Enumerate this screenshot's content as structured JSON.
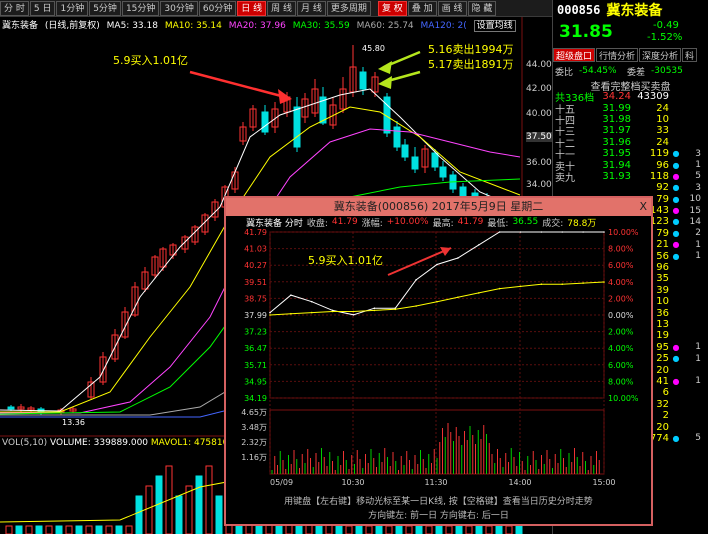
{
  "toolbar": {
    "periods": [
      "分 时",
      "5 日",
      "1分钟",
      "5分钟",
      "15分钟",
      "30分钟",
      "60分钟",
      "日 线",
      "周 线",
      "月 线",
      "更多周期"
    ],
    "active_period": "日 线",
    "right_buttons": [
      "复 权",
      "叠 加",
      "画 线",
      "隐 藏"
    ],
    "active_right": "复 权"
  },
  "legend": {
    "name": "冀东装备",
    "mode": "(日线,前复权)",
    "ma5": "MA5: 33.18",
    "ma10": "MA10: 35.14",
    "ma20": "MA20: 37.96",
    "ma30": "MA30: 35.59",
    "ma60": "MA60: 25.74",
    "ma120": "MA120: 2(",
    "settings": "设置均线"
  },
  "colors": {
    "up": "#ff3333",
    "down": "#00e0e0",
    "ma5": "#ffffff",
    "ma10": "#ffff00",
    "ma20": "#ff44ff",
    "ma30": "#00ff00",
    "ma60": "#aaaaaa",
    "ma120": "#4466ff",
    "price_line": "#ffffff",
    "avg_line": "#ffff00"
  },
  "annotations": {
    "buy_note": "5.9买入1.01亿",
    "sell_note1": "5.16卖出1994万",
    "sell_note2": "5.17卖出1891万",
    "popup_note": "5.9买入1.01亿",
    "peak": "45.80",
    "low": "13.36"
  },
  "price_axis": [
    "44.00",
    "42.00",
    "40.00",
    "37.50",
    "36.00",
    "34.00"
  ],
  "volume": {
    "label": "VOL(5,10)",
    "value": "VOLUME: 339889.000",
    "mavol": "MAVOL1: 475810"
  },
  "right_panel": {
    "code": "000856",
    "name": "冀东装备",
    "price": "31.85",
    "change": "-0.49",
    "pct": "-1.52%",
    "tabs": [
      "超级盘口",
      "行情分析",
      "深度分析",
      "科"
    ],
    "active_tab": "超级盘口",
    "ratio_label": "委比",
    "ratio_value": "-54.45%",
    "diff_label": "委差",
    "diff_value": "-30535",
    "full_book": "查看完整档买卖盘",
    "total_label": "共336档",
    "total_price": "34.24",
    "total_vol": "43309",
    "rows": [
      {
        "label": "十五",
        "price": "31.99",
        "vol": "24",
        "num": ""
      },
      {
        "label": "十四",
        "price": "31.98",
        "vol": "10",
        "num": ""
      },
      {
        "label": "十三",
        "price": "31.97",
        "vol": "33",
        "num": ""
      },
      {
        "label": "十二",
        "price": "31.96",
        "vol": "24",
        "num": ""
      },
      {
        "label": "十一",
        "price": "31.95",
        "vol": "119",
        "num": "3"
      },
      {
        "label": "卖十",
        "price": "31.94",
        "vol": "96",
        "num": "1"
      },
      {
        "label": "卖九",
        "price": "31.93",
        "vol": "118",
        "num": "5"
      },
      {
        "label": "",
        "price": "",
        "vol": "92",
        "num": "3"
      },
      {
        "label": "",
        "price": "",
        "vol": "79",
        "num": "10"
      },
      {
        "label": "",
        "price": "",
        "vol": "143",
        "num": "15"
      },
      {
        "label": "",
        "price": "",
        "vol": "123",
        "num": "14"
      },
      {
        "label": "",
        "price": "",
        "vol": "79",
        "num": "2"
      },
      {
        "label": "",
        "price": "",
        "vol": "21",
        "num": "1"
      },
      {
        "label": "",
        "price": "",
        "vol": "56",
        "num": "1"
      },
      {
        "label": "",
        "price": "",
        "vol": "96",
        "num": ""
      },
      {
        "label": "",
        "price": "",
        "vol": "35",
        "num": ""
      },
      {
        "label": "",
        "price": "",
        "vol": "39",
        "num": ""
      },
      {
        "label": "",
        "price": "",
        "vol": "10",
        "num": ""
      },
      {
        "label": "",
        "price": "",
        "vol": "36",
        "num": ""
      },
      {
        "label": "",
        "price": "",
        "vol": "13",
        "num": ""
      },
      {
        "label": "",
        "price": "",
        "vol": "19",
        "num": ""
      },
      {
        "label": "",
        "price": "",
        "vol": "95",
        "num": "1"
      },
      {
        "label": "",
        "price": "",
        "vol": "25",
        "num": "1"
      },
      {
        "label": "",
        "price": "",
        "vol": "20",
        "num": ""
      },
      {
        "label": "",
        "price": "",
        "vol": "41",
        "num": "1"
      },
      {
        "label": "",
        "price": "",
        "vol": "6",
        "num": ""
      },
      {
        "label": "",
        "price": "",
        "vol": "32",
        "num": ""
      },
      {
        "label": "",
        "price": "",
        "vol": "2",
        "num": ""
      },
      {
        "label": "",
        "price": "",
        "vol": "20",
        "num": ""
      },
      {
        "label": "",
        "price": "",
        "vol": "774",
        "num": "5"
      }
    ]
  },
  "popup": {
    "title": "冀东装备(000856) 2017年5月9日 星期二",
    "close": "X",
    "info_name": "冀东装备 分时",
    "info_close_label": "收盘:",
    "info_close": "41.79",
    "info_chg_label": "涨幅:",
    "info_chg": "+10.00%",
    "info_high_label": "最高:",
    "info_high": "41.79",
    "info_low_label": "最低:",
    "info_low": "36.55",
    "info_vol_label": "成交:",
    "info_vol": "78.8万",
    "left_axis": [
      "41.79",
      "41.03",
      "40.27",
      "39.51",
      "38.75",
      "37.99",
      "37.23",
      "36.47",
      "35.71",
      "34.95",
      "34.19"
    ],
    "right_axis": [
      "10.00%",
      "8.00%",
      "6.00%",
      "4.00%",
      "2.00%",
      "0.00%",
      "2.00%",
      "4.00%",
      "6.00%",
      "8.00%",
      "10.00%"
    ],
    "vol_axis": [
      "4.65万",
      "3.48万",
      "2.32万",
      "1.16万"
    ],
    "time_axis": [
      "05/09",
      "10:30",
      "11:30",
      "14:00",
      "15:00"
    ],
    "footer1": "用键盘【左右键】移动光标至某一日K线, 按【空格键】查看当日历史分时走势",
    "footer2": "方向键左: 前一日    方向键右: 后一日"
  },
  "chart_data": [
    {
      "type": "line",
      "title": "冀东装备 分时 2017-05-09",
      "x": [
        "09:30",
        "09:45",
        "10:00",
        "10:15",
        "10:30",
        "10:45",
        "11:00",
        "11:15",
        "11:30",
        "13:15",
        "13:30",
        "13:45",
        "14:00",
        "14:15",
        "14:30",
        "14:45",
        "15:00"
      ],
      "series": [
        {
          "name": "price",
          "values": [
            38.1,
            38.9,
            38.6,
            38.2,
            38.0,
            38.3,
            38.3,
            39.6,
            40.3,
            40.6,
            41.2,
            41.79,
            41.79,
            41.79,
            41.79,
            41.79,
            41.79
          ]
        },
        {
          "name": "avg",
          "values": [
            37.99,
            38.05,
            38.1,
            38.15,
            38.15,
            38.2,
            38.25,
            38.4,
            38.6,
            38.8,
            39.0,
            39.2,
            39.3,
            39.4,
            39.4,
            39.45,
            39.5
          ]
        }
      ],
      "ylim": [
        34.19,
        41.79
      ]
    }
  ]
}
